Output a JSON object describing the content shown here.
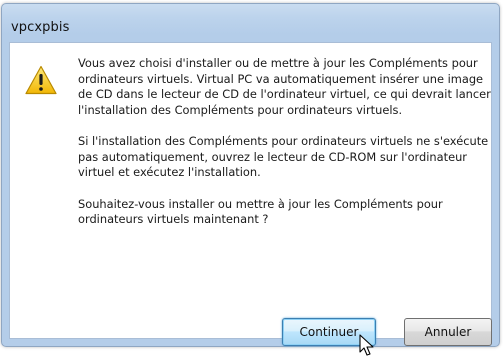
{
  "window": {
    "title": "vpcxpbis"
  },
  "icon": "warning-icon",
  "message": {
    "paragraph1": "Vous avez choisi d'installer ou de mettre à jour les Compléments pour ordinateurs virtuels. Virtual PC va automatiquement insérer une image de CD dans le lecteur de CD de l'ordinateur virtuel, ce qui devrait lancer l'installation des Compléments pour ordinateurs virtuels.",
    "paragraph2": "Si l'installation des Compléments pour ordinateurs virtuels ne s'exécute pas automatiquement, ouvrez le lecteur de CD-ROM sur l'ordinateur virtuel et exécutez l'installation.",
    "paragraph3": "Souhaitez-vous installer ou mettre à jour les Compléments pour ordinateurs virtuels maintenant ?"
  },
  "buttons": {
    "continue_label": "Continuer",
    "cancel_label": "Annuler"
  },
  "colors": {
    "frame": "#b4cde9",
    "focus_button": "#bee6fd",
    "warning_yellow": "#f7c914"
  }
}
